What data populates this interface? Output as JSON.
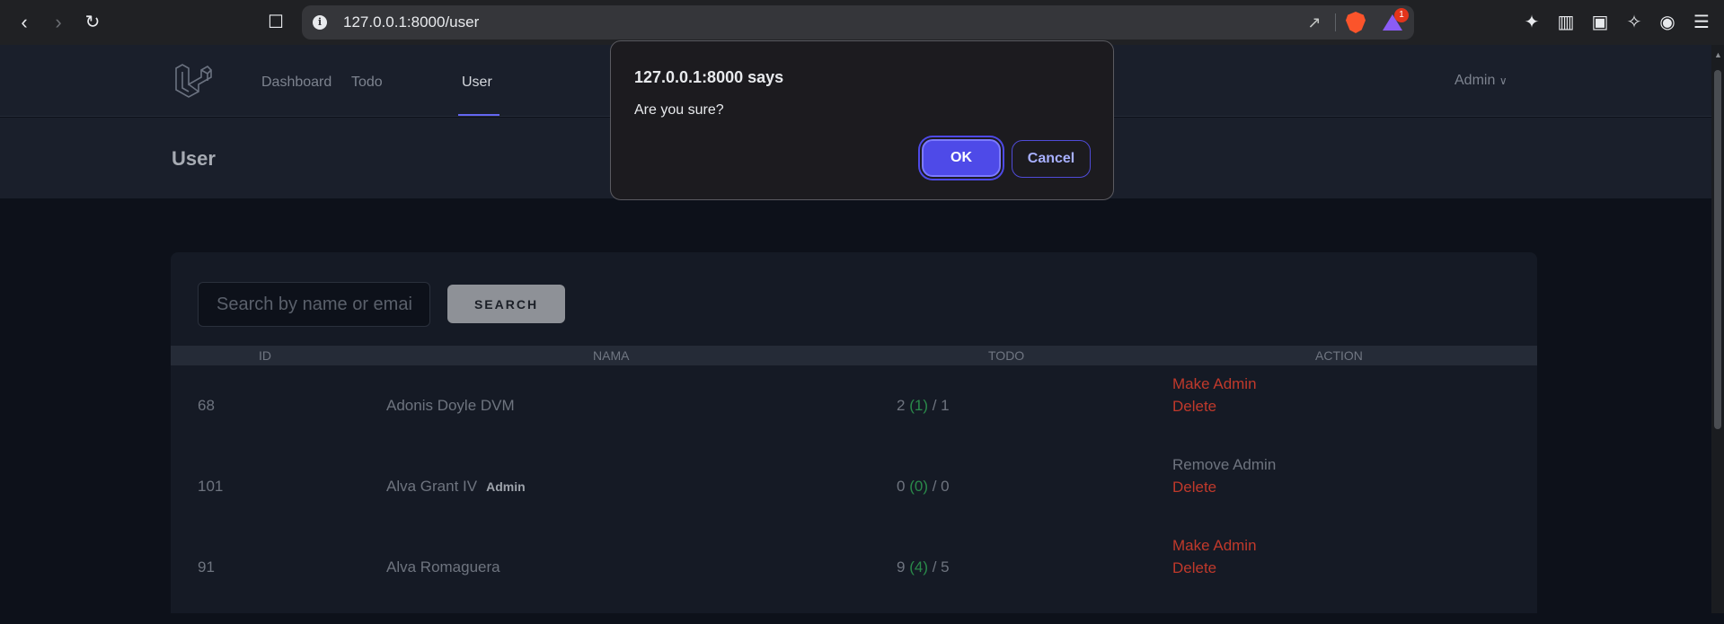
{
  "browser": {
    "url": "127.0.0.1:8000/user",
    "rewards_badge": "1"
  },
  "nav": {
    "links": [
      "Dashboard",
      "Todo",
      "User"
    ],
    "active": "User",
    "user_menu": "Admin"
  },
  "page": {
    "title": "User"
  },
  "search": {
    "placeholder": "Search by name or email",
    "button_label": "SEARCH"
  },
  "table": {
    "headers": [
      "ID",
      "NAMA",
      "TODO",
      "ACTION"
    ],
    "rows": [
      {
        "id": "68",
        "name": "Adonis Doyle DVM",
        "tag": "",
        "todo_total": "2",
        "todo_done": "(1)",
        "todo_open": "/ 1",
        "action1": "Make Admin",
        "action2": "Delete"
      },
      {
        "id": "101",
        "name": "Alva Grant IV",
        "tag": "Admin",
        "todo_total": "0",
        "todo_done": "(0)",
        "todo_open": "/ 0",
        "action1": "Remove Admin",
        "action2": "Delete"
      },
      {
        "id": "91",
        "name": "Alva Romaguera",
        "tag": "",
        "todo_total": "9",
        "todo_done": "(4)",
        "todo_open": "/ 5",
        "action1": "Make Admin",
        "action2": "Delete"
      }
    ]
  },
  "dialog": {
    "title": "127.0.0.1:8000 says",
    "message": "Are you sure?",
    "ok_label": "OK",
    "cancel_label": "Cancel"
  },
  "colors": {
    "accent": "#4e4ae8",
    "danger": "#c0392b",
    "success": "#2a8a4a"
  }
}
